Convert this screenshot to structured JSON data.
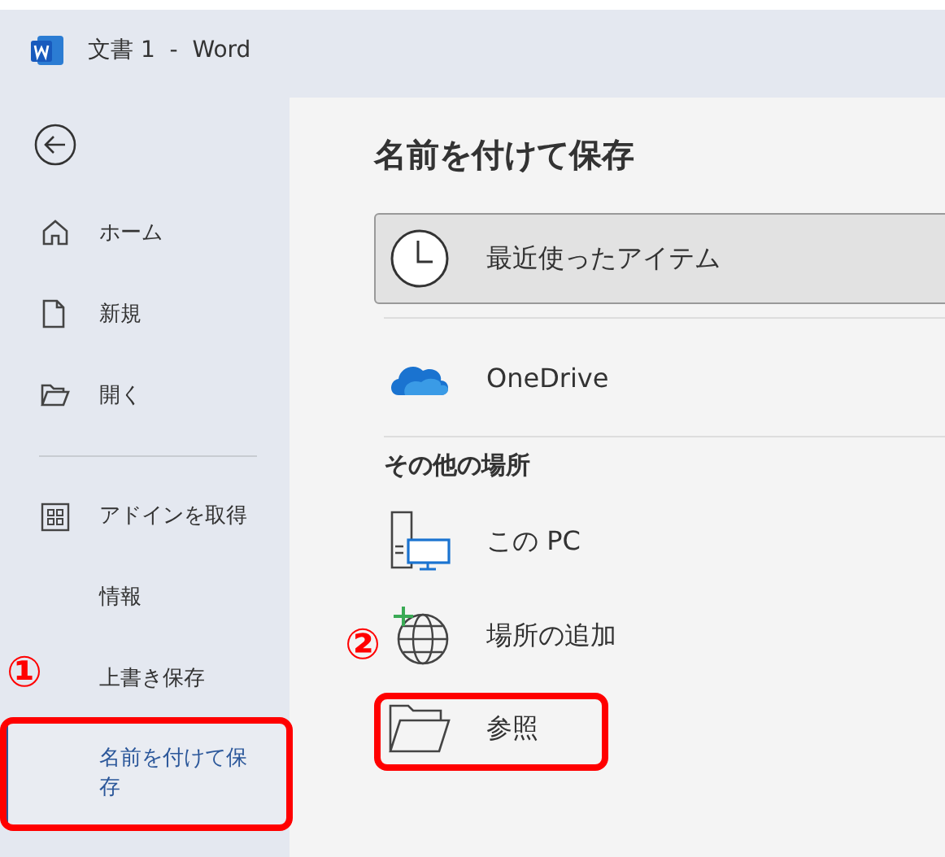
{
  "window": {
    "title": "文書 1  -  Word"
  },
  "sidebar": {
    "top_items": [
      {
        "label": "ホーム",
        "kind": "home",
        "selected": false
      },
      {
        "label": "新規",
        "kind": "new",
        "selected": false
      },
      {
        "label": "開く",
        "kind": "open",
        "selected": false
      }
    ],
    "bottom_items": [
      {
        "label": "アドインを取得",
        "kind": "addins",
        "selected": false
      },
      {
        "label": "情報",
        "kind": "plain",
        "selected": false
      },
      {
        "label": "上書き保存",
        "kind": "plain",
        "selected": false
      },
      {
        "label": "名前を付けて保存",
        "kind": "plain",
        "selected": true,
        "callout": "①"
      }
    ]
  },
  "main": {
    "title": "名前を付けて保存",
    "quick": [
      {
        "label": "最近使ったアイテム",
        "kind": "recent",
        "selected": true
      },
      {
        "label": "OneDrive",
        "kind": "onedrive",
        "selected": false
      }
    ],
    "other_heading": "その他の場所",
    "other": [
      {
        "label": "この PC",
        "kind": "pc",
        "selected": false
      },
      {
        "label": "場所の追加",
        "kind": "add",
        "selected": false
      },
      {
        "label": "参照",
        "kind": "browse",
        "selected": false,
        "callout": "②"
      }
    ]
  }
}
